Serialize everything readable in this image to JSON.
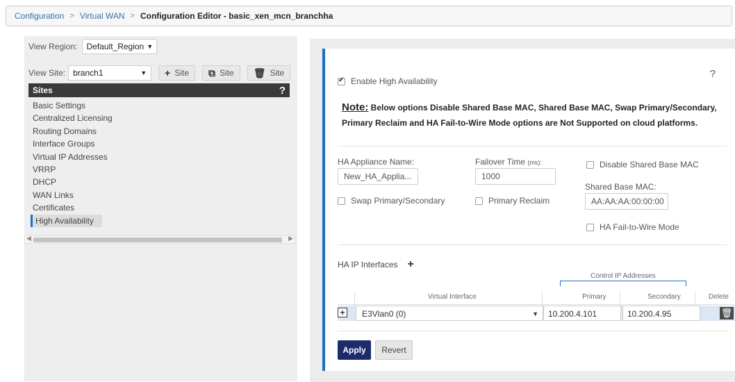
{
  "breadcrumb": {
    "items": [
      "Configuration",
      "Virtual WAN"
    ],
    "current": "Configuration Editor - basic_xen_mcn_branchha",
    "separator": ">"
  },
  "left": {
    "view_region_label": "View Region:",
    "view_region_value": "Default_Region",
    "view_site_label": "View Site:",
    "view_site_value": "branch1",
    "add_site_label": "Site",
    "copy_site_label": "Site",
    "delete_site_label": "Site",
    "sites_header": "Sites",
    "help": "?",
    "site_items": [
      "Basic Settings",
      "Centralized Licensing",
      "Routing Domains",
      "Interface Groups",
      "Virtual IP Addresses",
      "VRRP",
      "DHCP",
      "WAN Links",
      "Certificates",
      "High Availability"
    ],
    "active_item": "High Availability"
  },
  "card": {
    "help": "?",
    "enable_ha_label": "Enable High Availability",
    "enable_ha_checked": true,
    "note_title": "Note:",
    "note_text": "Below options Disable Shared Base MAC, Shared Base MAC, Swap Primary/Secondary, Primary Reclaim and HA Fail-to-Wire Mode options are Not Supported on cloud platforms.",
    "ha_appliance_name_label": "HA Appliance Name:",
    "ha_appliance_name_value": "New_HA_Applia...",
    "failover_time_label": "Failover Time",
    "failover_time_unit": "(ms):",
    "failover_time_value": "1000",
    "disable_shared_mac_label": "Disable Shared Base MAC",
    "shared_base_mac_label": "Shared Base MAC:",
    "shared_base_mac_value": "AA:AA:AA:00:00:00",
    "swap_label": "Swap Primary/Secondary",
    "primary_reclaim_label": "Primary Reclaim",
    "fail_to_wire_label": "HA Fail-to-Wire Mode",
    "ha_ip_interfaces_label": "HA IP Interfaces",
    "control_ip_label": "Control IP Addresses",
    "columns": {
      "virtual_interface": "Virtual Interface",
      "primary": "Primary",
      "secondary": "Secondary",
      "delete": "Delete"
    },
    "rows": [
      {
        "virtual_interface": "E3Vlan0 (0)",
        "primary": "10.200.4.101",
        "secondary": "10.200.4.95"
      }
    ],
    "apply_label": "Apply",
    "revert_label": "Revert"
  },
  "colors": {
    "accent": "#1a6fc4",
    "apply_bg": "#1c2b6b",
    "sites_header_bg": "#3a3a3a"
  }
}
